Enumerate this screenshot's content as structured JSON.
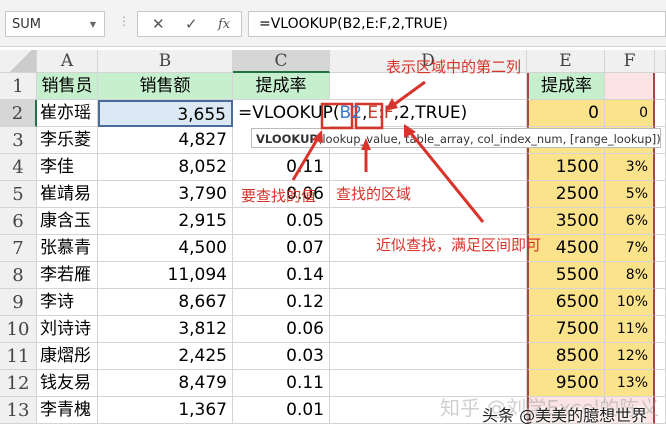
{
  "formula_bar": {
    "name_box": "SUM",
    "cancel": "✕",
    "enter": "✓",
    "fx": "fx",
    "formula": "=VLOOKUP(B2,E:F,2,TRUE)"
  },
  "columns": [
    "A",
    "B",
    "C",
    "D",
    "E",
    "F"
  ],
  "rows": [
    {
      "n": "1",
      "a": "销售员",
      "b": "销售额",
      "c": "提成率",
      "e": "提成率",
      "f": ""
    },
    {
      "n": "2",
      "a": "崔亦瑶",
      "b": "3,655",
      "c": "",
      "e": "0",
      "f": "0"
    },
    {
      "n": "3",
      "a": "李乐菱",
      "b": "4,827",
      "c": "",
      "e": "",
      "f": ""
    },
    {
      "n": "4",
      "a": "李佳",
      "b": "8,052",
      "c": "0.11",
      "e": "1500",
      "f": "3%"
    },
    {
      "n": "5",
      "a": "崔靖易",
      "b": "3,790",
      "c": "0.06",
      "e": "2500",
      "f": "5%"
    },
    {
      "n": "6",
      "a": "康含玉",
      "b": "2,915",
      "c": "0.05",
      "e": "3500",
      "f": "6%"
    },
    {
      "n": "7",
      "a": "张慕青",
      "b": "4,500",
      "c": "0.07",
      "e": "4500",
      "f": "7%"
    },
    {
      "n": "8",
      "a": "李若雁",
      "b": "11,094",
      "c": "0.14",
      "e": "5500",
      "f": "8%"
    },
    {
      "n": "9",
      "a": "李诗",
      "b": "8,667",
      "c": "0.12",
      "e": "6500",
      "f": "10%"
    },
    {
      "n": "10",
      "a": "刘诗诗",
      "b": "3,812",
      "c": "0.06",
      "e": "7500",
      "f": "11%"
    },
    {
      "n": "11",
      "a": "康熠彤",
      "b": "2,425",
      "c": "0.03",
      "e": "8500",
      "f": "12%"
    },
    {
      "n": "12",
      "a": "钱友易",
      "b": "8,479",
      "c": "0.11",
      "e": "9500",
      "f": "13%"
    },
    {
      "n": "13",
      "a": "李青槐",
      "b": "1,367",
      "c": "0.01",
      "e": "",
      "f": ""
    }
  ],
  "edit_cell": {
    "prefix": "=VLOOKUP(",
    "ref1": "B2",
    "sep": ",",
    "ref2": "E:F",
    "suffix": ",2,TRUE)"
  },
  "tooltip": {
    "fn": "VLOOKUP",
    "args": "(lookup_value, table_array, col_index_num, [range_lookup])"
  },
  "annotations": {
    "col2": "表示区域中的第二列",
    "lookup_value": "要查找的值",
    "range": "查找的区域",
    "approx": "近似查找，满足区间即可"
  },
  "watermark": {
    "zhihu": "知乎 @刘学Excel的陈义",
    "toutiao": "头条 @美美的臆想世界"
  }
}
